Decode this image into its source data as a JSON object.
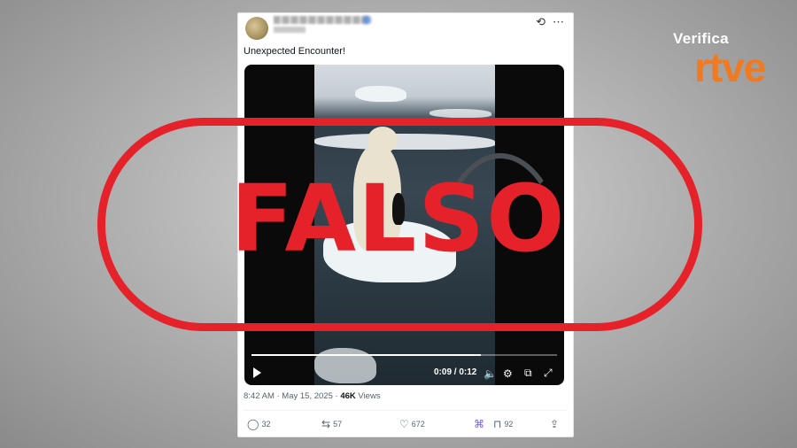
{
  "tweet": {
    "text": "Unexpected Encounter!",
    "timestamp": "8:42 AM · May 15, 2025",
    "separator": "·",
    "views_count": "46K",
    "views_label": "Views",
    "icons": {
      "grok": "grok-icon",
      "more": "more-icon"
    }
  },
  "video": {
    "current_time": "0:09",
    "duration": "0:12",
    "time_display": "0:09 / 0:12",
    "progress": 0.75
  },
  "actions": {
    "replies": "32",
    "reposts": "57",
    "likes": "672",
    "bookmarks": "92"
  },
  "overlay": {
    "verdict": "FALSO",
    "color": "#e5222a"
  },
  "brand": {
    "line1": "Verifica",
    "line2": "rtve",
    "accent": "#f07a22"
  }
}
